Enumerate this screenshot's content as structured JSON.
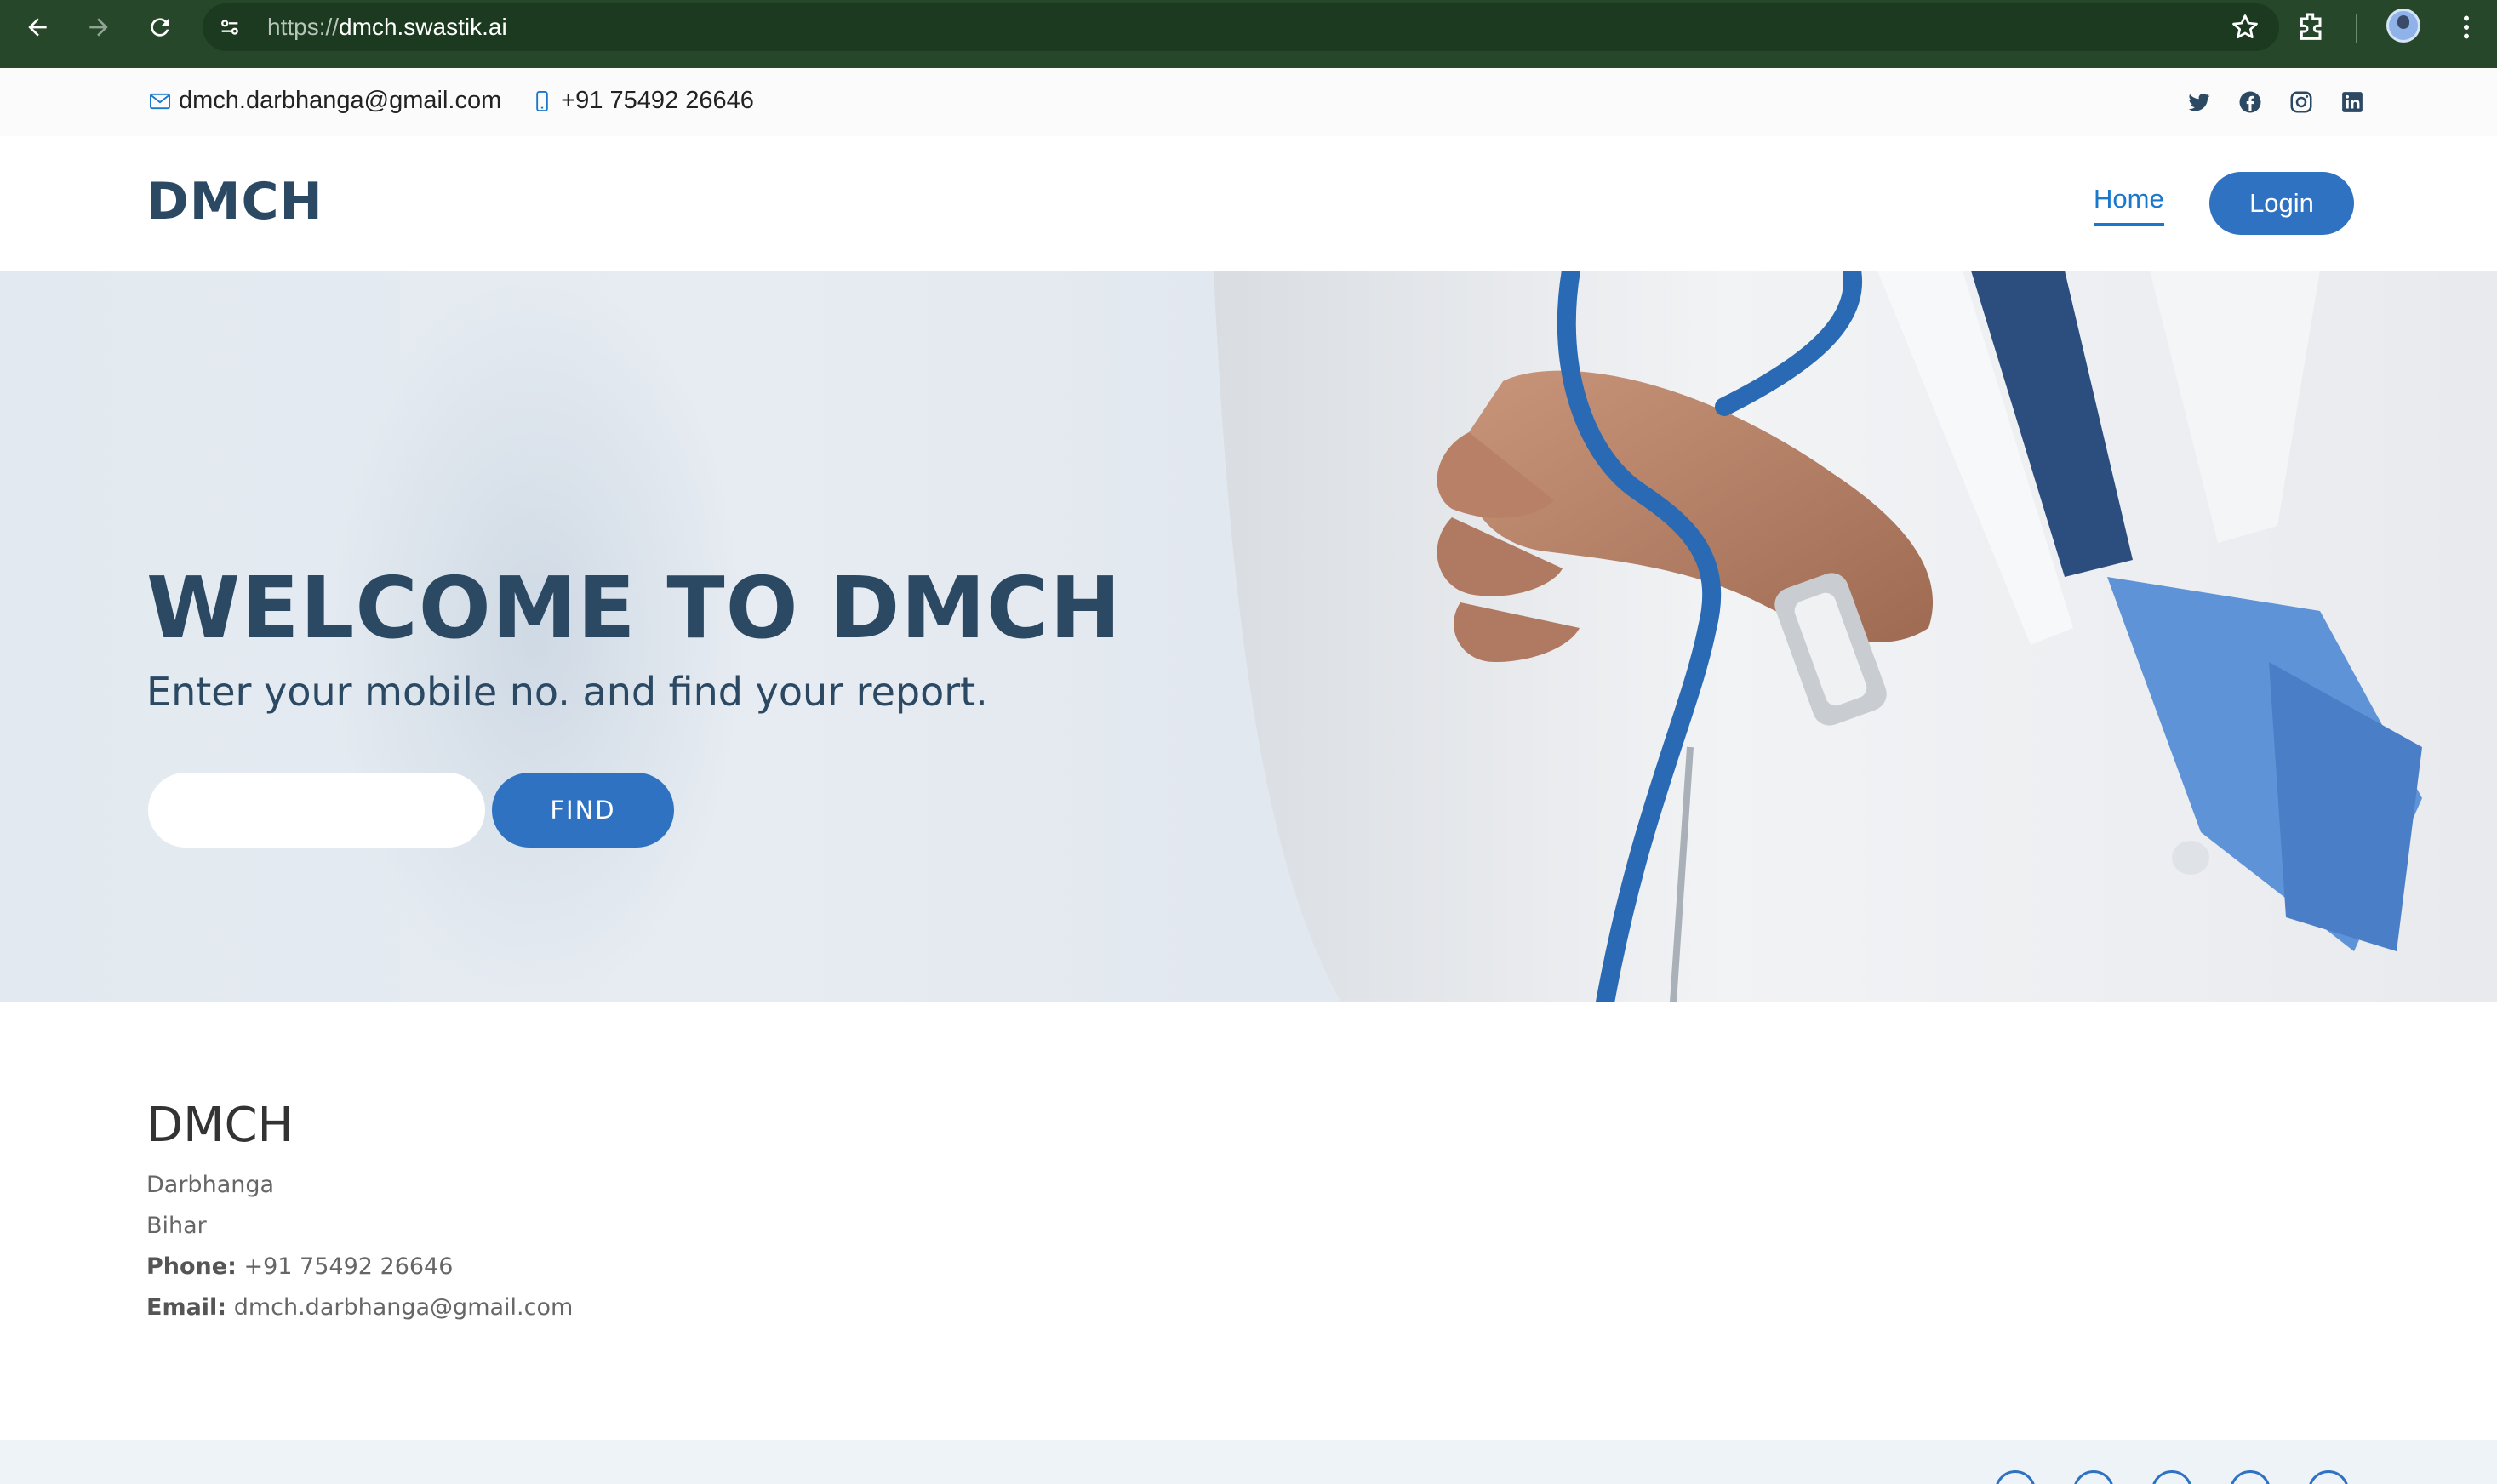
{
  "browser": {
    "url_scheme": "https://",
    "url_host": "dmch.swastik.ai"
  },
  "topbar": {
    "email": "dmch.darbhanga@gmail.com",
    "phone": "+91 75492 26646",
    "socials": [
      "twitter-icon",
      "facebook-icon",
      "instagram-icon",
      "linkedin-icon"
    ]
  },
  "header": {
    "logo": "DMCH",
    "nav_home": "Home",
    "login_label": "Login"
  },
  "hero": {
    "title": "WELCOME TO DMCH",
    "subtitle": "Enter your mobile no. and find your report.",
    "input_value": "",
    "find_label": "FIND"
  },
  "info": {
    "name": "DMCH",
    "city": "Darbhanga",
    "state": "Bihar",
    "phone_label": "Phone:",
    "phone_value": "+91 75492 26646",
    "email_label": "Email:",
    "email_value": "dmch.darbhanga@gmail.com"
  },
  "colors": {
    "accent": "#2f72c2",
    "heading": "#2c4964",
    "link": "#1977cc",
    "chrome": "#27472b"
  }
}
